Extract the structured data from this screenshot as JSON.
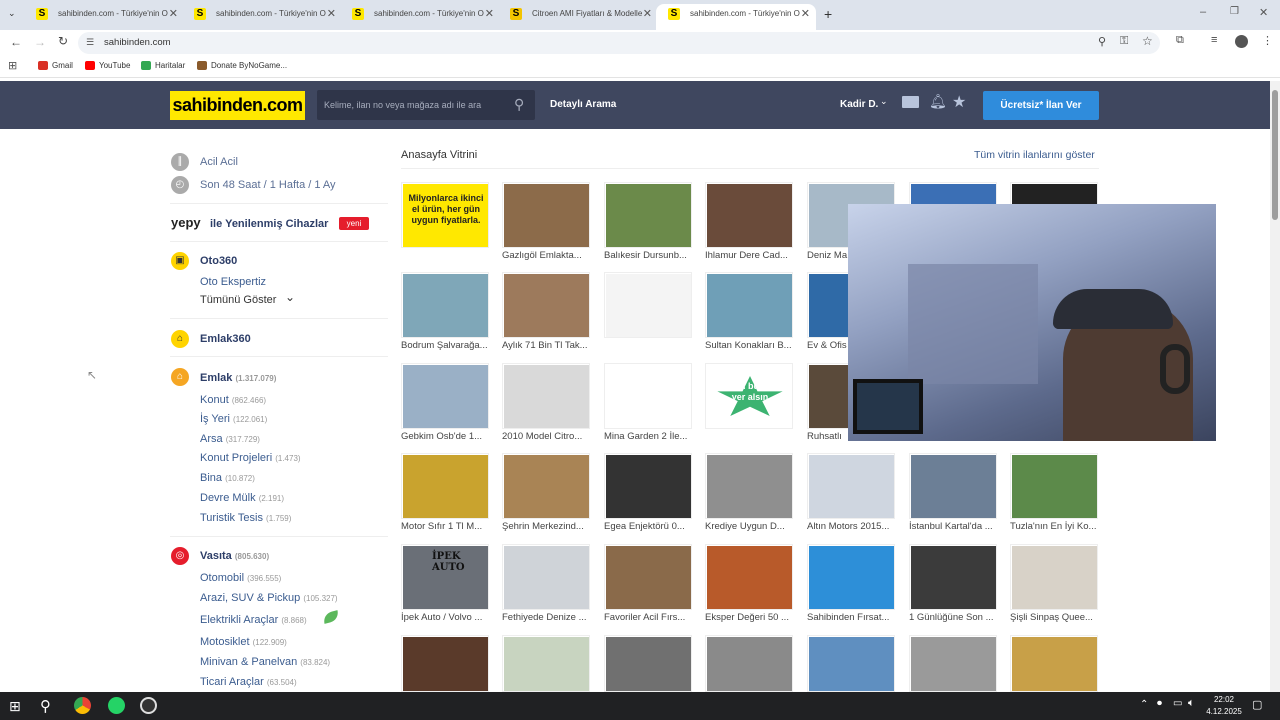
{
  "browser": {
    "tabs": [
      {
        "title": "sahibinden.com - Türkiye'nin O"
      },
      {
        "title": "sahibinden.com - Türkiye'nin O"
      },
      {
        "title": "sahibinden.com - Türkiye'nin O"
      },
      {
        "title": "Citroen AMI Fiyatları & Modelle"
      },
      {
        "title": "sahibinden.com - Türkiye'nin O"
      }
    ],
    "url": "sahibinden.com",
    "bookmarks": [
      "Gmail",
      "YouTube",
      "Haritalar",
      "Donate ByNoGame..."
    ]
  },
  "header": {
    "logo": "sahibinden.com",
    "search_placeholder": "Kelime, ilan no veya mağaza adı ile ara",
    "detailed_search": "Detaylı Arama",
    "user": "Kadir D.",
    "post_button": "Ücretsiz* İlan Ver"
  },
  "sidebar": {
    "acil": "Acil Acil",
    "recent": "Son 48 Saat / 1 Hafta / 1 Ay",
    "yepy_brand": "yepy",
    "yepy_text": "ile Yenilenmiş Cihazlar",
    "yepy_badge": "yeni",
    "oto360": "Oto360",
    "oto_ekspertiz": "Oto Ekspertiz",
    "show_all": "Tümünü Göster",
    "emlak360": "Emlak360",
    "emlak": {
      "label": "Emlak",
      "count": "(1.317.079)"
    },
    "emlak_items": [
      {
        "label": "Konut",
        "count": "(862.466)"
      },
      {
        "label": "İş Yeri",
        "count": "(122.061)"
      },
      {
        "label": "Arsa",
        "count": "(317.729)"
      },
      {
        "label": "Konut Projeleri",
        "count": "(1.473)"
      },
      {
        "label": "Bina",
        "count": "(10.872)"
      },
      {
        "label": "Devre Mülk",
        "count": "(2.191)"
      },
      {
        "label": "Turistik Tesis",
        "count": "(1.759)"
      }
    ],
    "vasita": {
      "label": "Vasıta",
      "count": "(805.630)"
    },
    "vasita_items": [
      {
        "label": "Otomobil",
        "count": "(396.555)"
      },
      {
        "label": "Arazi, SUV & Pickup",
        "count": "(105.327)"
      },
      {
        "label": "Elektrikli Araçlar",
        "count": "(8.868)"
      },
      {
        "label": "Motosiklet",
        "count": "(122.909)"
      },
      {
        "label": "Minivan & Panelvan",
        "count": "(83.824)"
      },
      {
        "label": "Ticari Araçlar",
        "count": "(63.504)"
      }
    ]
  },
  "vitrin": {
    "title": "Anasayfa Vitrini",
    "show_all": "Tüm vitrin ilanlarını göster",
    "promo_text": "Milyonlarca ikinci el ürün, her gün uygun fiyatlarla.",
    "rows": [
      [
        "",
        "Gazlıgöl Emlakta...",
        "Balıkesir Dursunb...",
        "Ihlamur Dere Cad...",
        "Deniz Ma",
        "",
        ""
      ],
      [
        "Bodrum Şalvarağa...",
        "Aylık 71 Bin Tl Tak...",
        "",
        "Sultan Konakları B...",
        "Ev & Ofis",
        "",
        ""
      ],
      [
        "Gebkim Osb'de 1...",
        "2010 Model Citro...",
        "Mina Garden 2 İle...",
        "",
        "Ruhsatlı",
        "",
        ""
      ],
      [
        "Motor Sıfır 1 Tl M...",
        "Şehrin Merkezind...",
        "Egea Enjektörü 0...",
        "Krediye Uygun D...",
        "Altın Motors 2015...",
        "İstanbul Kartal'da ...",
        "Tuzla'nın En İyi Ko..."
      ],
      [
        "İpek Auto / Volvo ...",
        "Fethiyede Denize ...",
        "Favoriler Acil Fırs...",
        "Eksper Değeri 50 ...",
        "Sahibinden Fırsat...",
        "1 Günlüğüne Son ...",
        "Şişli Sinpaş Quee..."
      ]
    ],
    "ilan_badge": "İlanın burada yer alsın",
    "ipek_sign": "İPEK AUTO"
  },
  "taskbar": {
    "time": "22:02",
    "date": "4.12.2025"
  }
}
